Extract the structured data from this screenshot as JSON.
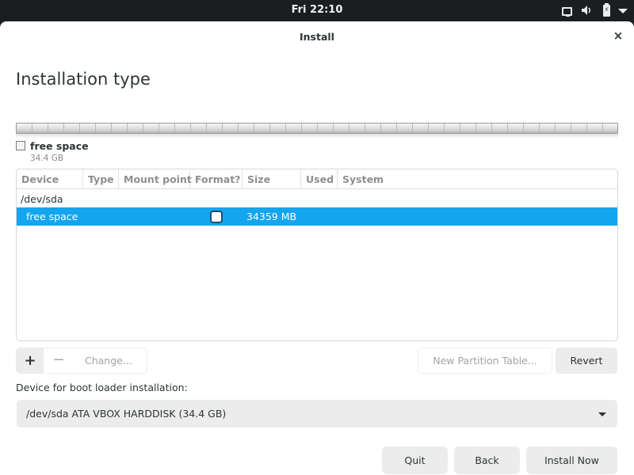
{
  "topbar": {
    "clock": "Fri 22:10",
    "tray_icons": [
      "screen-icon",
      "volume-icon",
      "battery-charging-icon",
      "system-menu-caret-icon"
    ]
  },
  "window": {
    "title": "Install",
    "close_glyph": "×"
  },
  "page": {
    "title": "Installation type"
  },
  "partition_bar": {
    "legend": [
      {
        "name": "free space",
        "size": "34.4 GB"
      }
    ]
  },
  "table": {
    "columns": [
      "Device",
      "Type",
      "Mount point",
      "Format?",
      "Size",
      "Used",
      "System"
    ],
    "rows": [
      {
        "device": "/dev/sda",
        "type": "",
        "mount_point": "",
        "format": null,
        "size": "",
        "used": "",
        "system": ""
      },
      {
        "device": "free space",
        "type": "",
        "mount_point": "",
        "format": false,
        "size": "34359 MB",
        "used": "",
        "system": "",
        "selected": true
      }
    ],
    "selected_color": "#14a5ef"
  },
  "toolbar": {
    "add_label": "+",
    "remove_label": "−",
    "change_label": "Change...",
    "new_table_label": "New Partition Table...",
    "revert_label": "Revert"
  },
  "bootloader": {
    "label": "Device for boot loader installation:",
    "selected": "/dev/sda ATA VBOX HARDDISK (34.4 GB)"
  },
  "actions": {
    "quit_label": "Quit",
    "back_label": "Back",
    "install_label": "Install Now"
  }
}
